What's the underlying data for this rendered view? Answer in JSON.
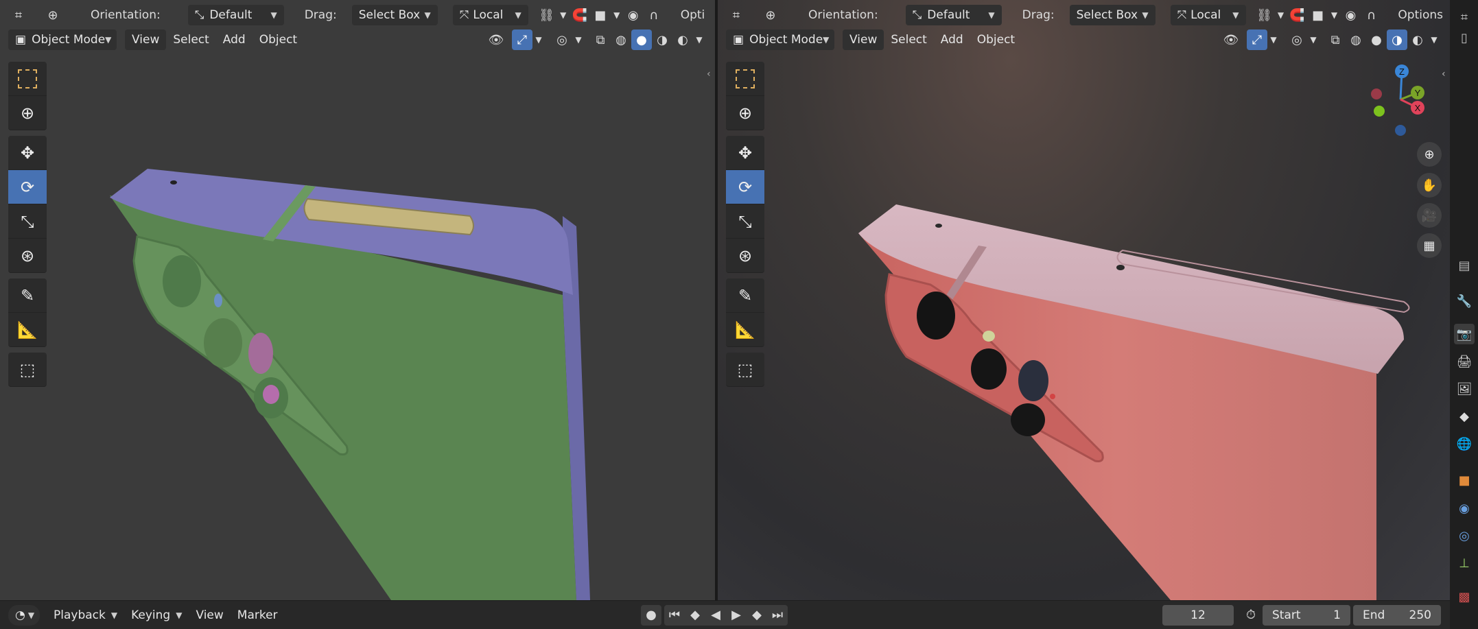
{
  "header": {
    "orientation_label": "Orientation:",
    "orientation_value": "Default",
    "drag_label": "Drag:",
    "drag_value": "Select Box",
    "transform_space": "Local",
    "options_left": "Opti",
    "options_right": "Options"
  },
  "viewport_menu": {
    "mode": "Object Mode",
    "view": "View",
    "select": "Select",
    "add": "Add",
    "object": "Object"
  },
  "gizmo": {
    "z": "Z",
    "y": "Y",
    "x": "X"
  },
  "timeline": {
    "playback": "Playback",
    "keying": "Keying",
    "view": "View",
    "marker": "Marker",
    "current_frame": "12",
    "start_label": "Start",
    "start_value": "1",
    "end_label": "End",
    "end_value": "250"
  },
  "colors": {
    "accent": "#4772b3",
    "phone_green": "#5d8a55",
    "phone_purple": "#7a78b8",
    "phone_pink": "#d9837f"
  },
  "icons": {
    "select_box": "select-box-icon",
    "cursor": "cursor-icon",
    "move": "move-icon",
    "rotate": "rotate-icon",
    "scale": "scale-icon",
    "transform": "transform-icon",
    "annotate": "annotate-icon",
    "measure": "measure-icon",
    "add_cube": "add-cube-icon"
  }
}
